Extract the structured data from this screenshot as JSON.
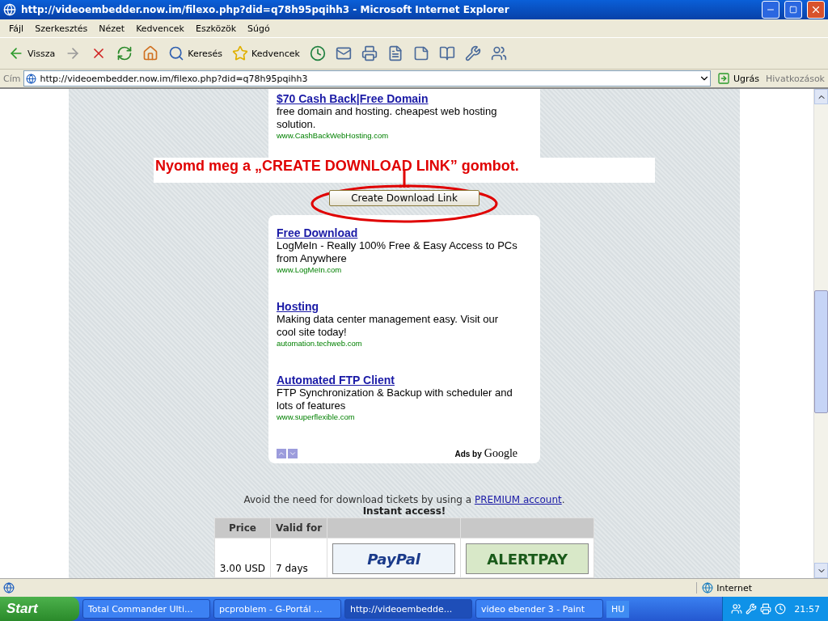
{
  "window": {
    "title": "http://videoembedder.now.im/filexo.php?did=q78h95pqihh3 - Microsoft Internet Explorer"
  },
  "menu": [
    "Fájl",
    "Szerkesztés",
    "Nézet",
    "Kedvencek",
    "Eszközök",
    "Súgó"
  ],
  "toolbar": [
    {
      "kind": "back",
      "label": "Vissza"
    },
    {
      "kind": "forward"
    },
    {
      "kind": "stop"
    },
    {
      "kind": "refresh"
    },
    {
      "kind": "home"
    },
    {
      "kind": "search",
      "label": "Keresés"
    },
    {
      "kind": "favorites",
      "label": "Kedvencek"
    },
    {
      "kind": "history"
    },
    {
      "kind": "mail"
    },
    {
      "kind": "print"
    },
    {
      "kind": "edit"
    },
    {
      "kind": "note"
    },
    {
      "kind": "research"
    },
    {
      "kind": "tools"
    },
    {
      "kind": "messenger"
    }
  ],
  "address": {
    "label": "Cím",
    "url": "http://videoembedder.now.im/filexo.php?did=q78h95pqihh3",
    "go": "Ugrás",
    "links": "Hivatkozások"
  },
  "page": {
    "top_ad": {
      "title": "$70 Cash Back|Free Domain",
      "text": "free domain and hosting. cheapest web hosting solution.",
      "url": "www.CashBackWebHosting.com"
    },
    "annotation": "Nyomd meg a „CREATE DOWNLOAD LINK” gombot.",
    "button": "Create Download Link",
    "ads": [
      {
        "title": "Free Download",
        "text": "LogMeIn - Really 100% Free & Easy Access to PCs from Anywhere",
        "url": "www.LogMeIn.com"
      },
      {
        "title": "Hosting",
        "text": "Making data center management easy. Visit our cool site today!",
        "url": "automation.techweb.com"
      },
      {
        "title": "Automated FTP Client",
        "text": "FTP Synchronization & Backup with scheduler and lots of features",
        "url": "www.superflexible.com"
      }
    ],
    "ads_by": "Ads by",
    "ads_brand": "Google",
    "premium_text": "Avoid the need for download tickets by using a",
    "premium_link": "PREMIUM account",
    "premium_end": ".",
    "instant": "Instant access!",
    "table": {
      "columns": [
        "Price",
        "Valid for",
        "",
        ""
      ],
      "rows": [
        {
          "price": "3.00 USD",
          "valid": "7 days",
          "pay1": "PayPal",
          "pay2": "ALERTPAY"
        }
      ]
    }
  },
  "status_bar": {
    "zone": "Internet"
  },
  "taskbar": {
    "start": "Start",
    "tasks": [
      {
        "label": "Total Commander Ulti...",
        "selected": false
      },
      {
        "label": "pcproblem - G-Portál ...",
        "selected": false
      },
      {
        "label": "http://videoembedde...",
        "selected": true
      },
      {
        "label": "video ebender 3 - Paint",
        "selected": false
      }
    ],
    "lang": "HU",
    "clock": "21:57"
  }
}
